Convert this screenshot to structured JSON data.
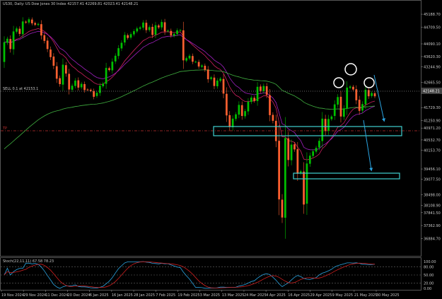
{
  "header": {
    "title": "US30, Daily:  US Dow Jones 30 Index  42157.41 42269.81 42023.41 42148.21"
  },
  "sell_line": {
    "label": "SELL 0.1 at 42153.1",
    "price_tag": "42148.21",
    "value": 42148.21
  },
  "tp_line": {
    "label": "TP",
    "value": 40620
  },
  "price_axis": {
    "ticks": [
      "45188.70",
      "44709.50",
      "44090.10",
      "43620.30",
      "43244.90",
      "42665.50",
      "42148.21",
      "41729.30",
      "41250.90",
      "40971.20",
      "40532.70",
      "40153.70",
      "39456.10",
      "39077.50",
      "38498.00",
      "38108.90",
      "37841.50",
      "37362.90",
      "36884.70"
    ],
    "tick_values": [
      45188.7,
      44709.5,
      44090.1,
      43620.3,
      43244.9,
      42665.5,
      42148.21,
      41729.3,
      41250.9,
      40971.2,
      40532.7,
      40153.7,
      39456.1,
      39077.5,
      38498.0,
      38108.9,
      37841.5,
      37362.9,
      36884.7
    ]
  },
  "time_axis": {
    "labels": [
      "19 Nov 2024",
      "29 Nov 2024",
      "11 Dec 2024",
      "20 Dec 2024",
      "6 Jan 2025",
      "16 Jan 2025",
      "28 Jan 2025",
      "7 Feb 2025",
      "19 Feb 2025",
      "3 Mar 2025",
      "13 Mar 2025",
      "24 Mar 2025",
      "4 Apr 2025",
      "16 Apr 2025",
      "29 Apr 2025",
      "9 May 2025",
      "21 May 2025",
      "30 May 2025"
    ]
  },
  "stochastic": {
    "title": "Stoch(22,11,11) 67.58 78.23",
    "ticks": [
      "100.00",
      "80.00",
      "50.00",
      "20.00",
      "0.00"
    ],
    "tick_values": [
      100,
      80,
      50,
      20,
      0
    ]
  },
  "colors": {
    "bull": "#00c000",
    "bear": "#ff6030",
    "ema_fast": "#d02060",
    "ema_mid": "#a020c0",
    "sma_long": "#40b040",
    "zone": "#40d0d0",
    "arrow": "#2aa3e0",
    "stoch_main": "#2aa3e0",
    "stoch_signal": "#d02020"
  },
  "chart_data": {
    "type": "candlestick",
    "title": "US30, Daily:  US Dow Jones 30 Index  42157.41 42269.81 42023.41 42148.21",
    "ylim": [
      36500,
      45400
    ],
    "points": [
      [
        43420,
        44150
      ],
      [
        44130,
        44280
      ],
      [
        44270,
        43900
      ],
      [
        43890,
        44550
      ],
      [
        44540,
        44660
      ],
      [
        44650,
        44460
      ],
      [
        44450,
        44920
      ],
      [
        44910,
        44880
      ],
      [
        44880,
        45000
      ],
      [
        44990,
        44850
      ],
      [
        44860,
        44800
      ],
      [
        44790,
        44830
      ],
      [
        44820,
        44400
      ],
      [
        44410,
        44200
      ],
      [
        44210,
        43900
      ],
      [
        43880,
        43600
      ],
      [
        43620,
        43280
      ],
      [
        43260,
        42800
      ],
      [
        42820,
        42600
      ],
      [
        42580,
        43320
      ],
      [
        43300,
        42990
      ],
      [
        42980,
        42400
      ],
      [
        42390,
        42540
      ],
      [
        42530,
        42730
      ],
      [
        42740,
        42470
      ],
      [
        42480,
        42610
      ],
      [
        42600,
        42380
      ],
      [
        42400,
        42390
      ],
      [
        42390,
        42350
      ],
      [
        42340,
        42130
      ],
      [
        42160,
        42280
      ],
      [
        42270,
        42540
      ],
      [
        42520,
        42620
      ],
      [
        42610,
        43200
      ],
      [
        43190,
        43120
      ],
      [
        43110,
        43430
      ],
      [
        43440,
        43650
      ],
      [
        43640,
        43930
      ],
      [
        43920,
        44130
      ],
      [
        44140,
        44420
      ],
      [
        44410,
        44310
      ],
      [
        44320,
        44450
      ],
      [
        44440,
        44560
      ],
      [
        44550,
        44660
      ],
      [
        44650,
        44700
      ],
      [
        44690,
        44880
      ],
      [
        44870,
        44600
      ],
      [
        44600,
        44710
      ],
      [
        44720,
        44420
      ],
      [
        44430,
        44780
      ],
      [
        44770,
        44700
      ],
      [
        44700,
        44900
      ],
      [
        44890,
        44550
      ],
      [
        44560,
        44580
      ],
      [
        44570,
        44400
      ],
      [
        44390,
        44460
      ],
      [
        44450,
        44590
      ],
      [
        44580,
        44600
      ],
      [
        44590,
        43480
      ],
      [
        43470,
        43560
      ],
      [
        43550,
        43650
      ],
      [
        43640,
        43430
      ],
      [
        43420,
        43430
      ],
      [
        43420,
        43250
      ],
      [
        43240,
        43290
      ],
      [
        43280,
        43130
      ],
      [
        43140,
        42780
      ],
      [
        42790,
        42850
      ],
      [
        42840,
        42530
      ],
      [
        42520,
        42730
      ],
      [
        42720,
        42800
      ],
      [
        42790,
        42250
      ],
      [
        42240,
        41440
      ],
      [
        41450,
        41010
      ],
      [
        41000,
        41320
      ],
      [
        41310,
        41480
      ],
      [
        41470,
        41830
      ],
      [
        41820,
        41420
      ],
      [
        41410,
        41600
      ],
      [
        41590,
        41950
      ],
      [
        41940,
        42100
      ],
      [
        42090,
        41980
      ],
      [
        41970,
        42500
      ],
      [
        42510,
        42350
      ],
      [
        42340,
        42530
      ],
      [
        42520,
        42200
      ],
      [
        42190,
        41450
      ],
      [
        41460,
        41240
      ],
      [
        41240,
        40490
      ],
      [
        40500,
        38330
      ],
      [
        38320,
        37660
      ],
      [
        37650,
        40600
      ],
      [
        40590,
        39790
      ],
      [
        39780,
        40360
      ],
      [
        40370,
        40180
      ],
      [
        40190,
        39280
      ],
      [
        39290,
        39370
      ],
      [
        39360,
        38140
      ],
      [
        38170,
        39660
      ],
      [
        39650,
        39950
      ],
      [
        39940,
        40110
      ],
      [
        40100,
        40240
      ],
      [
        40250,
        40500
      ],
      [
        40490,
        41320
      ],
      [
        41310,
        40860
      ],
      [
        40870,
        41310
      ],
      [
        41300,
        41400
      ],
      [
        41420,
        41850
      ],
      [
        41840,
        42120
      ],
      [
        42130,
        41400
      ],
      [
        41390,
        41700
      ],
      [
        41690,
        42470
      ],
      [
        42460,
        42510
      ],
      [
        42500,
        42400
      ],
      [
        42410,
        42000
      ],
      [
        42020,
        41610
      ],
      [
        41620,
        41860
      ],
      [
        41850,
        42390
      ],
      [
        42380,
        42150
      ],
      [
        42160,
        42270
      ],
      [
        42260,
        42148
      ]
    ],
    "series_order": [
      "open",
      "close"
    ],
    "annotations": [
      "SELL 0.1 at 42153.1",
      "TP"
    ]
  }
}
